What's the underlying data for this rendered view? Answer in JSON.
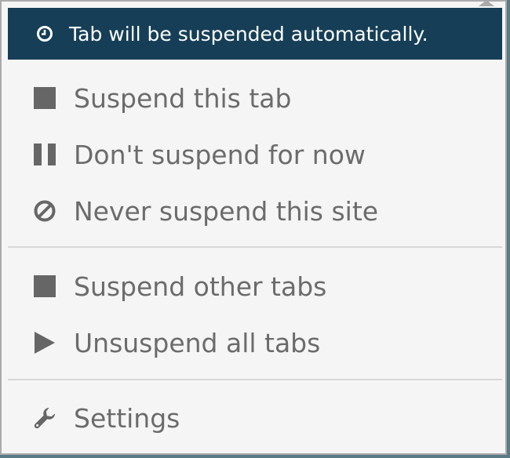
{
  "status": {
    "icon": "clock-icon",
    "text": "Tab will be suspended automatically."
  },
  "menu": {
    "suspend_this_tab": {
      "label": "Suspend this tab",
      "icon": "stop-square-icon"
    },
    "dont_suspend": {
      "label": "Don't suspend for now",
      "icon": "pause-icon"
    },
    "never_suspend": {
      "label": "Never suspend this site",
      "icon": "ban-icon"
    },
    "suspend_other_tabs": {
      "label": "Suspend other tabs",
      "icon": "stop-square-icon"
    },
    "unsuspend_all": {
      "label": "Unsuspend all tabs",
      "icon": "play-icon"
    },
    "settings": {
      "label": "Settings",
      "icon": "wrench-icon"
    }
  },
  "colors": {
    "header_bg": "#163f57",
    "item_text": "#6b6b6b",
    "icon": "#666666",
    "background": "#f5f5f5"
  }
}
